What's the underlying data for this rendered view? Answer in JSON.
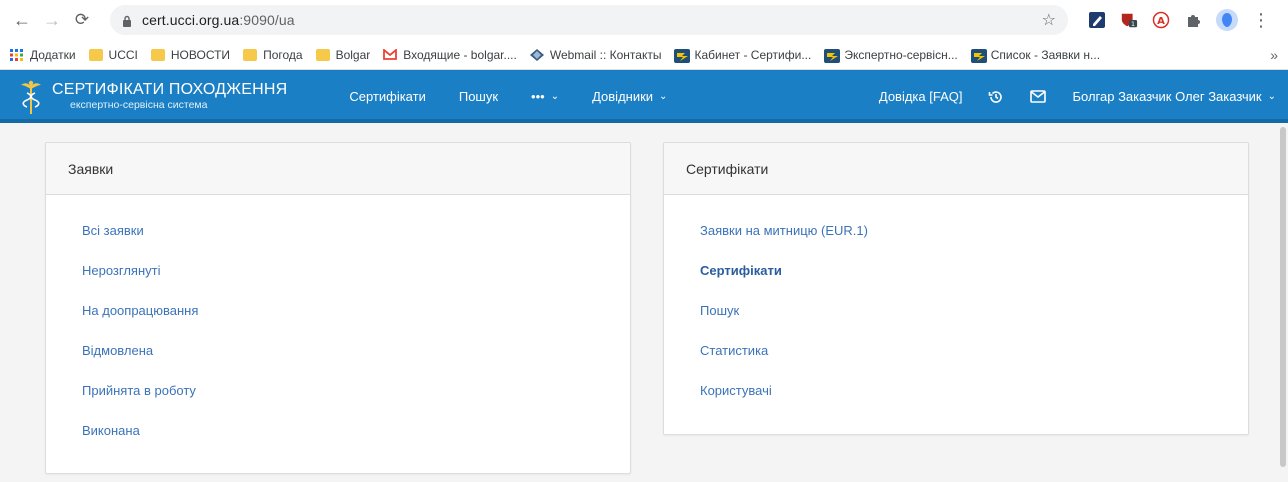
{
  "browser": {
    "url_host": "cert.ucci.org.ua",
    "url_path": ":9090/ua",
    "bookmarks": [
      {
        "label": "Додатки",
        "icon": "apps-grid-icon"
      },
      {
        "label": "UCCI",
        "icon": "folder-icon"
      },
      {
        "label": "НОВОСТИ",
        "icon": "folder-icon"
      },
      {
        "label": "Погода",
        "icon": "folder-icon"
      },
      {
        "label": "Bolgar",
        "icon": "folder-icon"
      },
      {
        "label": "Входящие - bolgar....",
        "icon": "gmail-icon"
      },
      {
        "label": "Webmail :: Контакты",
        "icon": "webmail-icon"
      },
      {
        "label": "Кабинет - Сертифи...",
        "icon": "site-icon"
      },
      {
        "label": "Экспертно-сервісн...",
        "icon": "site-icon"
      },
      {
        "label": "Список - Заявки н...",
        "icon": "site-icon"
      }
    ],
    "bookmarks_more": "»"
  },
  "header": {
    "brand_title": "СЕРТИФІКАТИ ПОХОДЖЕННЯ",
    "brand_subtitle": "експертно-сервісна система",
    "nav": {
      "certificates": "Сертифікати",
      "search": "Пошук",
      "more": "•••",
      "directories": "Довідники"
    },
    "help": "Довідка [FAQ]",
    "user": "Болгар Заказчик Олег Заказчик",
    "colors": {
      "bar": "#1a7fc4"
    }
  },
  "panels": {
    "requests": {
      "title": "Заявки",
      "links": [
        "Всі заявки",
        "Нерозглянуті",
        "На доопрацювання",
        "Відмовлена",
        "Прийнята в роботу",
        "Виконана"
      ]
    },
    "certificates": {
      "title": "Сертифікати",
      "links": [
        "Заявки на митницю (EUR.1)",
        "Сертифікати",
        "Пошук",
        "Статистика",
        "Користувачі"
      ]
    }
  }
}
